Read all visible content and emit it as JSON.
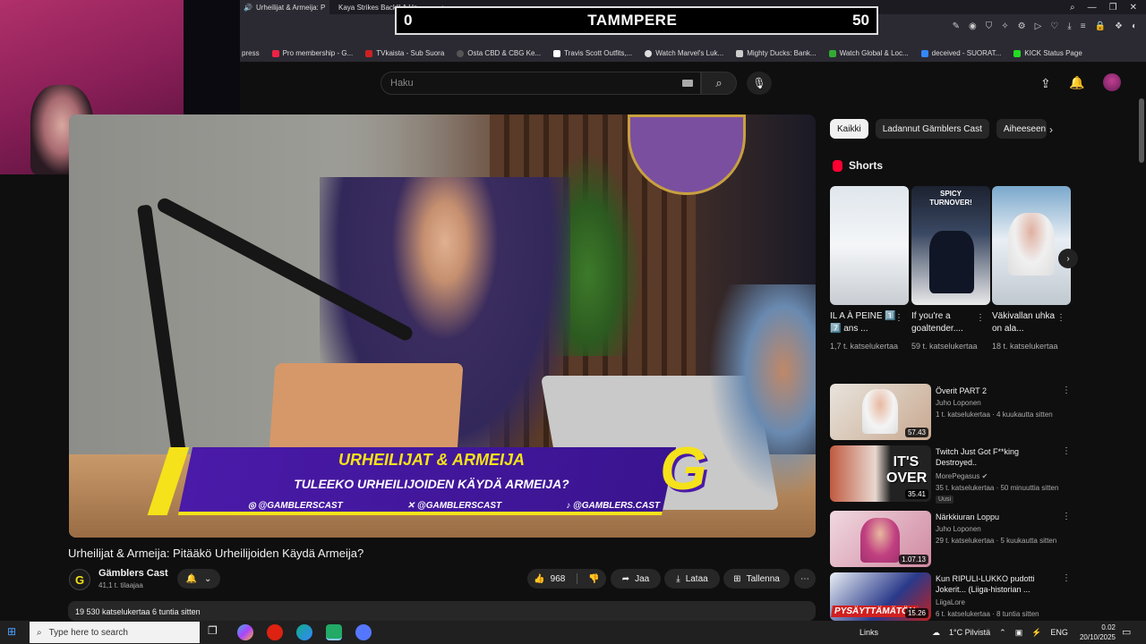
{
  "browser": {
    "tabs": [
      {
        "label": "Urheilijat & Armeija: P",
        "active": true
      },
      {
        "label": "Kaya Strikes Back!! A Ha...",
        "active": false
      }
    ],
    "bookmarks": [
      "press",
      "Pro membership - G...",
      "TVkaista - Sub Suora",
      "Osta CBD & CBG Ke...",
      "Travis Scott Outfits,...",
      "Watch Marvel's Luk...",
      "Mighty Ducks: Bank...",
      "Watch Global & Loc...",
      "deceived - SUORAT...",
      "KICK Status Page"
    ]
  },
  "scoreboard": {
    "left": "0",
    "team": "TAMMPERE",
    "right": "50"
  },
  "youtube": {
    "search_placeholder": "Haku",
    "video": {
      "lower_third_title": "URHEILIJAT & ARMEIJA",
      "lower_third_subtitle": "TULEEKO URHEILIJOIDEN KÄYDÄ ARMEIJA?",
      "socials": [
        "@GAMBLERSCAST",
        "@GAMBLERSCAST",
        "@GAMBLERS.CAST"
      ],
      "logo_letter": "G"
    },
    "title": "Urheilijat & Armeija: Pitääkö Urheilijoiden Käydä Armeija?",
    "channel": {
      "name": "Gämblers Cast",
      "subs": "41,1 t. tilaajaa",
      "avatar_letter": "G"
    },
    "actions": {
      "likes": "968",
      "share": "Jaa",
      "download": "Lataa",
      "save": "Tallenna"
    },
    "description": "19 530 katselukertaa  6 tuntia sitten",
    "chips": [
      "Kaikki",
      "Ladannut Gämblers Cast",
      "Aiheeseen l"
    ],
    "shorts_label": "Shorts",
    "shorts": [
      {
        "title": "IL A À PEINE 1️⃣ 7️⃣ ans ...",
        "views": "1,7 t. katselukertaa"
      },
      {
        "title": "If you're a goaltender....",
        "views": "59 t. katselukertaa"
      },
      {
        "title": "Väkivallan uhka on ala...",
        "views": "18 t. katselukertaa"
      }
    ],
    "shorts_overlay_text": "SPICY TURNOVER!",
    "recommended": [
      {
        "title": "Överit PART 2",
        "channel": "Juho Loponen",
        "meta": "1 t. katselukertaa · 4 kuukautta sitten",
        "duration": "57.43"
      },
      {
        "title": "Twitch Just Got F**king Destroyed..",
        "channel": "MorePegasus",
        "meta": "35 t. katselukertaa · 50 minuuttia sitten",
        "duration": "35.41",
        "badge": "Uusi",
        "thumb_text": "IT'S OVER"
      },
      {
        "title": "Närkkiuran Loppu",
        "channel": "Juho Loponen",
        "meta": "29 t. katselukertaa · 5 kuukautta sitten",
        "duration": "1.07.13"
      },
      {
        "title": "Kun RIPULI-LUKKO pudotti Jokerit... (Liiga-historian ...",
        "channel": "LiigaLore",
        "meta": "6 t. katselukertaa · 8 tuntia sitten",
        "duration": "15.26",
        "thumb_text": "PYSÄYTTÄMÄTÖN"
      }
    ]
  },
  "taskbar": {
    "search_placeholder": "Type here to search",
    "links": "Links",
    "weather": "1°C  Pilvistä",
    "lang": "ENG",
    "time": "0.02",
    "date": "20/10/2025"
  }
}
